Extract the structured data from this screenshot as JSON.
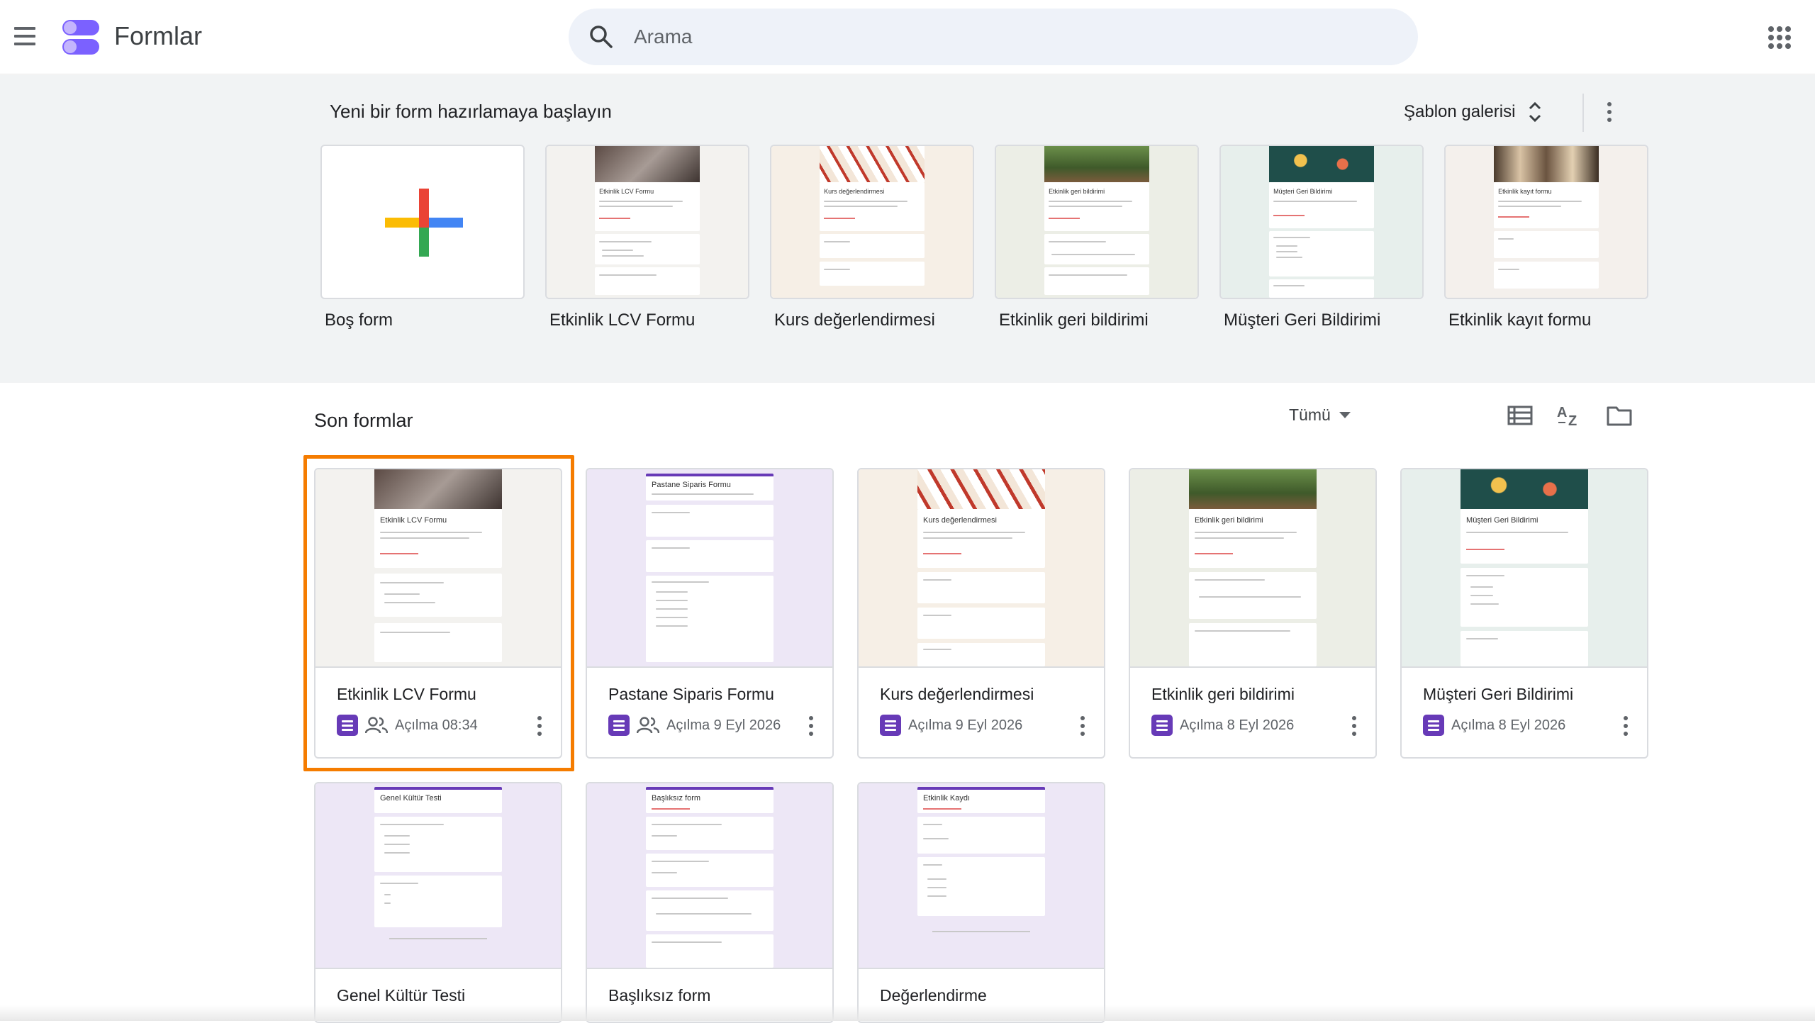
{
  "header": {
    "app_title": "Formlar",
    "search_placeholder": "Arama"
  },
  "templates": {
    "heading": "Yeni bir form hazırlamaya başlayın",
    "gallery_label": "Şablon galerisi",
    "items": [
      {
        "name": "Boş form"
      },
      {
        "name": "Etkinlik LCV Formu",
        "preview_title": "Etkinlik LCV Formu",
        "bg": "#f3f2ef"
      },
      {
        "name": "Kurs değerlendirmesi",
        "preview_title": "Kurs değerlendirmesi",
        "bg": "#f6efe6"
      },
      {
        "name": "Etkinlik geri bildirimi",
        "preview_title": "Etkinlik geri bildirimi",
        "bg": "#eceee6"
      },
      {
        "name": "Müşteri Geri Bildirimi",
        "preview_title": "Müşteri Geri Bildirimi",
        "bg": "#e7efec"
      },
      {
        "name": "Etkinlik kayıt formu",
        "preview_title": "Etkinlik kayıt formu",
        "bg": "#f4f0ec"
      }
    ]
  },
  "recent": {
    "title": "Son formlar",
    "filter_label": "Tümü",
    "docs": [
      {
        "title": "Etkinlik LCV Formu",
        "meta": "Açılma 08:34",
        "shared": true,
        "preview_title": "Etkinlik LCV Formu",
        "bg": "#f3f2ef"
      },
      {
        "title": "Pastane Siparis Formu",
        "meta": "Açılma 9 Eyl 2026",
        "shared": true,
        "preview_title": "Pastane Siparis Formu",
        "bg": "#ede7f6"
      },
      {
        "title": "Kurs değerlendirmesi",
        "meta": "Açılma 9 Eyl 2026",
        "shared": false,
        "preview_title": "Kurs değerlendirmesi",
        "bg": "#f6efe6"
      },
      {
        "title": "Etkinlik geri bildirimi",
        "meta": "Açılma 8 Eyl 2026",
        "shared": false,
        "preview_title": "Etkinlik geri bildirimi",
        "bg": "#eceee6"
      },
      {
        "title": "Müşteri Geri Bildirimi",
        "meta": "Açılma 8 Eyl 2026",
        "shared": false,
        "preview_title": "Müşteri Geri Bildirimi",
        "bg": "#e7efec"
      },
      {
        "title": "Genel Kültür Testi",
        "preview_title": "Genel Kültür Testi",
        "bg": "#ede7f6"
      },
      {
        "title": "Başlıksız form",
        "preview_title": "Başlıksız form",
        "bg": "#ede7f6"
      },
      {
        "title": "Değerlendirme",
        "preview_title": "Etkinlik Kaydı",
        "bg": "#ede7f6"
      }
    ]
  },
  "colors": {
    "accent": "#673ab7",
    "selection": "#f57c00"
  }
}
